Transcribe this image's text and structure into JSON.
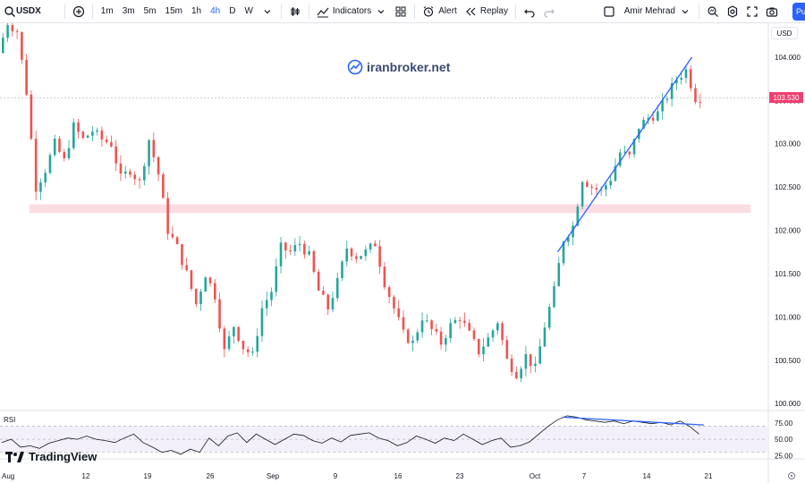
{
  "toolbar": {
    "symbol": "USDX",
    "timeframes": [
      "1m",
      "3m",
      "5m",
      "15m",
      "1h",
      "4h",
      "D",
      "W"
    ],
    "active_timeframe": "4h",
    "indicators_label": "Indicators",
    "alert_label": "Alert",
    "replay_label": "Replay",
    "user_name": "Amir Mehrad",
    "publish_label": "Pu"
  },
  "chart": {
    "currency": "USD",
    "watermark": "iranbroker.net",
    "current_price": "103.530",
    "price_ticks": [
      "104.000",
      "103.500",
      "103.000",
      "102.500",
      "102.000",
      "101.500",
      "101.000",
      "100.500",
      "100.000"
    ],
    "time_ticks": [
      "Aug",
      "12",
      "19",
      "26",
      "Sep",
      "9",
      "16",
      "23",
      "Oct",
      "7",
      "14",
      "21"
    ],
    "rsi_label": "RSI",
    "rsi_ticks": [
      "75.00",
      "50.00",
      "25.00"
    ],
    "brand": "TradingView",
    "colors": {
      "up": "#26a69a",
      "down": "#ef5350",
      "zone": "#fcdce3",
      "trend": "#2962ff",
      "price": "#f23f6f"
    }
  },
  "chart_data": {
    "type": "candlestick",
    "ylim": [
      99.95,
      104.35
    ],
    "price_path": [
      [
        0,
        104.05
      ],
      [
        2,
        104.4
      ],
      [
        4,
        104.3
      ],
      [
        6,
        103.6
      ],
      [
        8,
        102.5
      ],
      [
        10,
        102.7
      ],
      [
        12,
        103.0
      ],
      [
        14,
        102.8
      ],
      [
        16,
        103.2
      ],
      [
        18,
        103.05
      ],
      [
        20,
        103.15
      ],
      [
        22,
        103.05
      ],
      [
        24,
        103.0
      ],
      [
        26,
        102.6
      ],
      [
        28,
        102.7
      ],
      [
        30,
        102.55
      ],
      [
        32,
        103.05
      ],
      [
        34,
        102.65
      ],
      [
        36,
        102.0
      ],
      [
        38,
        101.8
      ],
      [
        40,
        101.5
      ],
      [
        42,
        101.15
      ],
      [
        44,
        101.5
      ],
      [
        46,
        101.25
      ],
      [
        48,
        100.6
      ],
      [
        50,
        100.9
      ],
      [
        52,
        100.65
      ],
      [
        54,
        100.55
      ],
      [
        56,
        101.1
      ],
      [
        58,
        101.3
      ],
      [
        60,
        101.8
      ],
      [
        62,
        101.75
      ],
      [
        64,
        101.85
      ],
      [
        66,
        101.7
      ],
      [
        68,
        101.3
      ],
      [
        70,
        101.1
      ],
      [
        72,
        101.4
      ],
      [
        74,
        101.8
      ],
      [
        76,
        101.7
      ],
      [
        78,
        101.75
      ],
      [
        80,
        101.85
      ],
      [
        82,
        101.4
      ],
      [
        84,
        101.1
      ],
      [
        86,
        100.8
      ],
      [
        88,
        100.7
      ],
      [
        90,
        101.0
      ],
      [
        92,
        100.85
      ],
      [
        94,
        100.7
      ],
      [
        96,
        100.9
      ],
      [
        98,
        101.0
      ],
      [
        100,
        100.8
      ],
      [
        102,
        100.6
      ],
      [
        104,
        100.75
      ],
      [
        106,
        100.95
      ],
      [
        108,
        100.5
      ],
      [
        110,
        100.35
      ],
      [
        112,
        100.55
      ],
      [
        114,
        100.4
      ],
      [
        116,
        100.9
      ],
      [
        118,
        101.3
      ],
      [
        120,
        101.9
      ],
      [
        122,
        102.05
      ],
      [
        124,
        102.6
      ],
      [
        126,
        102.5
      ],
      [
        128,
        102.45
      ],
      [
        130,
        102.6
      ],
      [
        132,
        102.9
      ],
      [
        134,
        102.85
      ],
      [
        136,
        103.2
      ],
      [
        138,
        103.3
      ],
      [
        140,
        103.35
      ],
      [
        142,
        103.55
      ],
      [
        144,
        103.75
      ],
      [
        146,
        103.85
      ],
      [
        148,
        103.53
      ]
    ],
    "resistance_zone": [
      102.2,
      102.3
    ],
    "trendline": [
      [
        102.0,
        101.75
      ],
      [
        103.7,
        104.0
      ]
    ],
    "rsi_ylim": [
      20,
      90
    ],
    "rsi_path": [
      [
        0,
        45
      ],
      [
        2,
        50
      ],
      [
        4,
        38
      ],
      [
        6,
        40
      ],
      [
        8,
        36
      ],
      [
        10,
        44
      ],
      [
        12,
        48
      ],
      [
        14,
        52
      ],
      [
        16,
        50
      ],
      [
        18,
        55
      ],
      [
        20,
        50
      ],
      [
        22,
        48
      ],
      [
        24,
        45
      ],
      [
        26,
        52
      ],
      [
        28,
        58
      ],
      [
        30,
        45
      ],
      [
        32,
        38
      ],
      [
        34,
        30
      ],
      [
        36,
        33
      ],
      [
        38,
        27
      ],
      [
        40,
        35
      ],
      [
        42,
        30
      ],
      [
        44,
        52
      ],
      [
        46,
        40
      ],
      [
        48,
        55
      ],
      [
        50,
        60
      ],
      [
        52,
        45
      ],
      [
        54,
        58
      ],
      [
        56,
        50
      ],
      [
        58,
        42
      ],
      [
        60,
        50
      ],
      [
        62,
        58
      ],
      [
        64,
        56
      ],
      [
        66,
        48
      ],
      [
        68,
        44
      ],
      [
        70,
        52
      ],
      [
        72,
        46
      ],
      [
        74,
        56
      ],
      [
        76,
        58
      ],
      [
        78,
        60
      ],
      [
        80,
        52
      ],
      [
        82,
        48
      ],
      [
        84,
        40
      ],
      [
        86,
        45
      ],
      [
        88,
        55
      ],
      [
        90,
        50
      ],
      [
        92,
        44
      ],
      [
        94,
        52
      ],
      [
        96,
        48
      ],
      [
        98,
        58
      ],
      [
        100,
        50
      ],
      [
        102,
        42
      ],
      [
        104,
        48
      ],
      [
        106,
        52
      ],
      [
        108,
        38
      ],
      [
        110,
        40
      ],
      [
        112,
        46
      ],
      [
        114,
        58
      ],
      [
        116,
        70
      ],
      [
        118,
        80
      ],
      [
        120,
        86
      ],
      [
        122,
        84
      ],
      [
        124,
        80
      ],
      [
        126,
        78
      ],
      [
        128,
        76
      ],
      [
        130,
        78
      ],
      [
        132,
        74
      ],
      [
        134,
        78
      ],
      [
        136,
        76
      ],
      [
        138,
        74
      ],
      [
        140,
        76
      ],
      [
        142,
        72
      ],
      [
        144,
        78
      ],
      [
        146,
        70
      ],
      [
        148,
        58
      ]
    ],
    "rsi_divergence": [
      [
        84.0
      ],
      [
        72.0
      ]
    ]
  }
}
